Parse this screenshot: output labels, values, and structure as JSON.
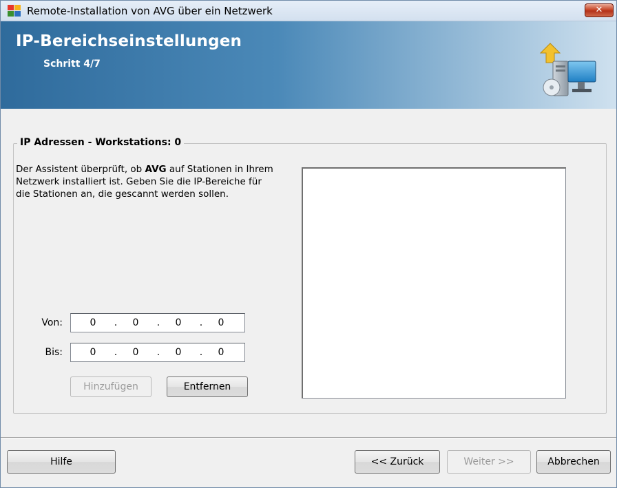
{
  "window": {
    "title": "Remote-Installation von AVG über ein Netzwerk",
    "close_label": "✕"
  },
  "header": {
    "title": "IP-Bereichseinstellungen",
    "step": "Schritt 4/7"
  },
  "group": {
    "legend": "IP Adressen - Workstations: 0",
    "description_pre": "Der Assistent überprüft, ob ",
    "description_bold": "AVG",
    "description_post": " auf Stationen in Ihrem Netzwerk installiert ist. Geben Sie die IP-Bereiche für die Stationen an, die gescannt werden sollen."
  },
  "range": {
    "from_label": "Von:",
    "from_octets": [
      "0",
      "0",
      "0",
      "0"
    ],
    "to_label": "Bis:",
    "to_octets": [
      "0",
      "0",
      "0",
      "0"
    ],
    "separator": "."
  },
  "buttons": {
    "add_label": "Hinzufügen",
    "remove_label": "Entfernen",
    "help_label": "Hilfe",
    "back_label": "<< Zurück",
    "next_label": "Weiter >>",
    "cancel_label": "Abbrechen"
  },
  "range_list": {
    "items": []
  },
  "icons": {
    "app": "avg-app-icon",
    "close": "close-icon",
    "header": "network-install-icon"
  },
  "colors": {
    "header_dark": "#2f6b9c",
    "header_light": "#cfe1ef",
    "close_red": "#c7482a"
  }
}
